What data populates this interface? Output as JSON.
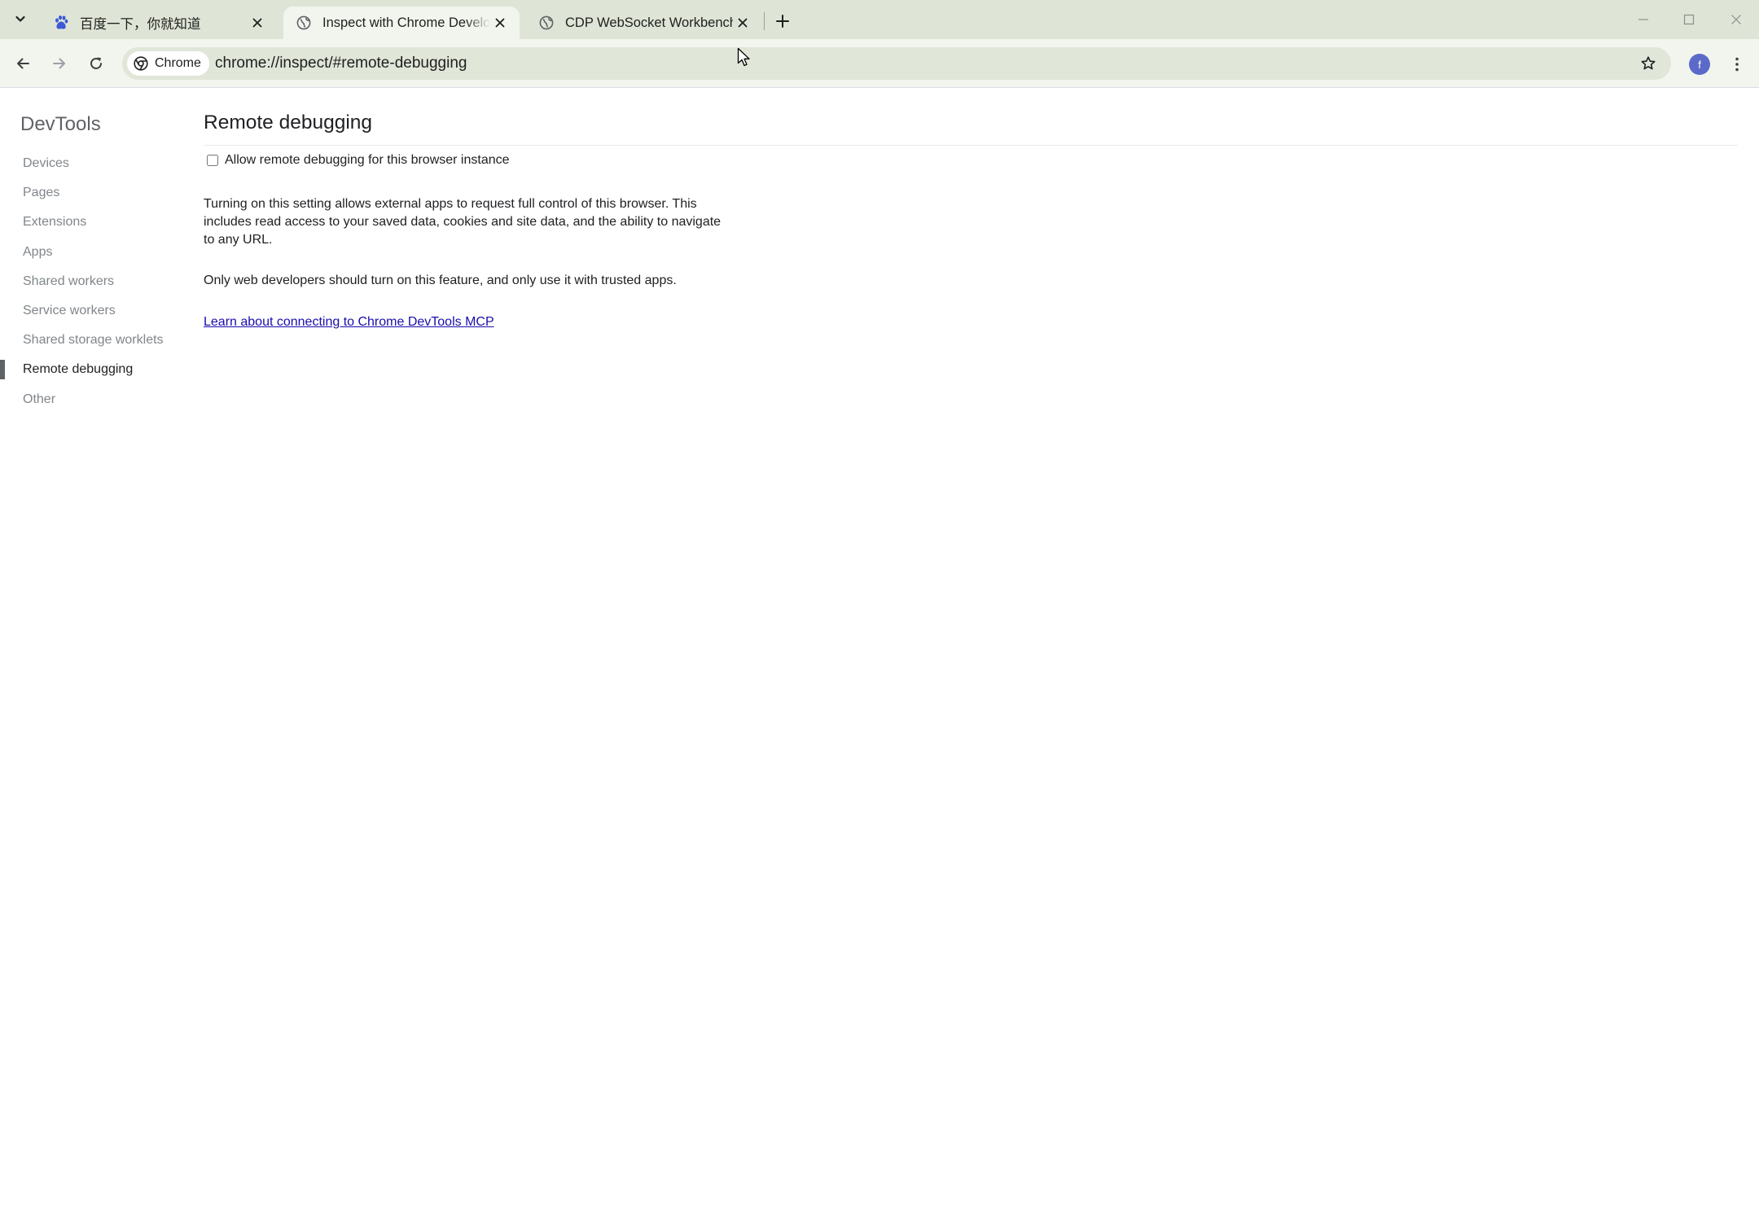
{
  "browser": {
    "tabs": [
      {
        "title": "百度一下，你就知道",
        "favicon": "baidu-paw-icon",
        "active": false
      },
      {
        "title": "Inspect with Chrome Developer Tools",
        "favicon": "globe-icon",
        "active": true
      },
      {
        "title": "CDP WebSocket Workbench",
        "favicon": "globe-icon",
        "active": false
      }
    ],
    "omnibox": {
      "chip_label": "Chrome",
      "url": "chrome://inspect/#remote-debugging"
    },
    "profile_initial": "f",
    "colors": {
      "frame": "#dfe5d6",
      "toolbar": "#f2f5ed",
      "omnibox": "#e0e6d8",
      "avatar": "#5b6ac8"
    }
  },
  "sidebar": {
    "title": "DevTools",
    "items": [
      {
        "label": "Devices"
      },
      {
        "label": "Pages"
      },
      {
        "label": "Extensions"
      },
      {
        "label": "Apps"
      },
      {
        "label": "Shared workers"
      },
      {
        "label": "Service workers"
      },
      {
        "label": "Shared storage worklets"
      },
      {
        "label": "Remote debugging",
        "selected": true
      },
      {
        "label": "Other"
      }
    ]
  },
  "main": {
    "title": "Remote debugging",
    "checkbox_label": "Allow remote debugging for this browser instance",
    "checkbox_checked": false,
    "paragraph1": "Turning on this setting allows external apps to request full control of this browser. This includes read access to your saved data, cookies and site data, and the ability to navigate to any URL.",
    "paragraph2": "Only web developers should turn on this feature, and only use it with trusted apps.",
    "link_text": "Learn about connecting to Chrome DevTools MCP",
    "link_color": "#1a0dab"
  }
}
